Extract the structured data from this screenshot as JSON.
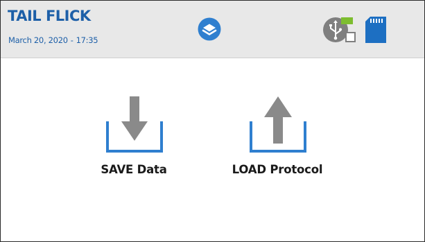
{
  "header": {
    "title": "TAIL FLICK",
    "date": "March 20, 2020",
    "date_separator": "-",
    "time": "17:35"
  },
  "status_icons": {
    "menu": "layers-icon",
    "usb": "usb-drive-icon",
    "sd": "sd-card-icon"
  },
  "actions": [
    {
      "label": "SAVE Data",
      "icon": "download-tray-icon"
    },
    {
      "label": "LOAD Protocol",
      "icon": "upload-tray-icon"
    }
  ],
  "colors": {
    "brand_blue": "#1d5fa8",
    "tray_blue": "#2f7fcf",
    "arrow_gray": "#8a8a8a",
    "usb_gray": "#7f7f7f",
    "usb_accent": "#7dbd2f",
    "header_bg": "#e8e8e8"
  }
}
